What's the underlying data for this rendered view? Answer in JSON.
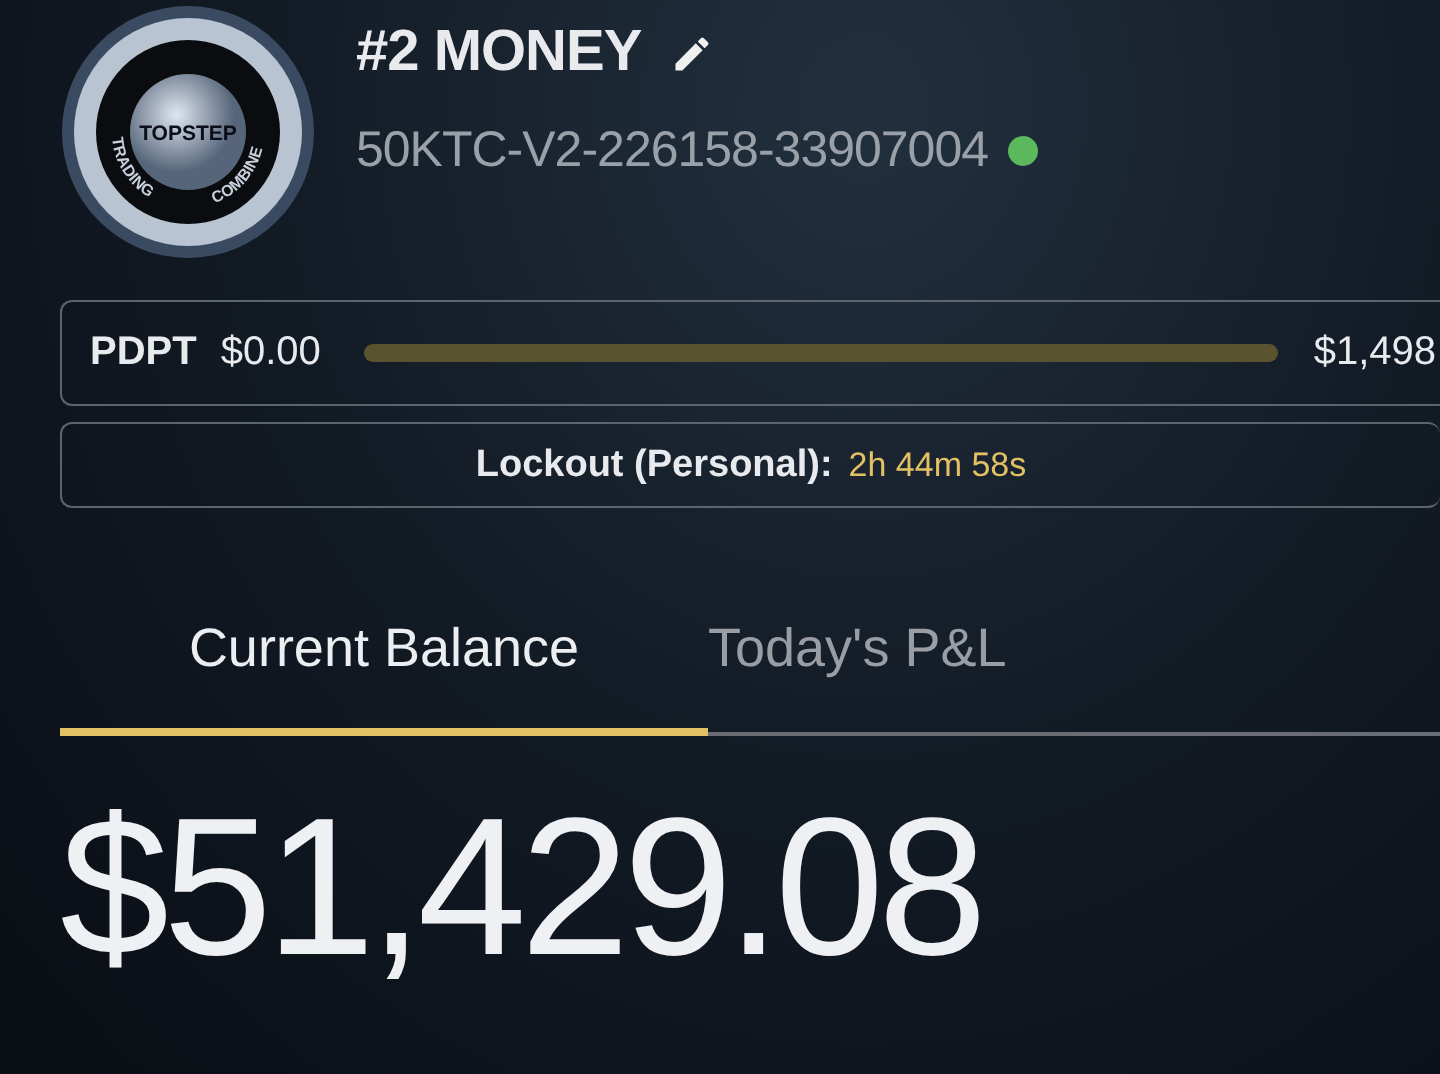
{
  "logo": {
    "center": "TOPSTEP",
    "left": "TRADING",
    "right": "COMBINE"
  },
  "account": {
    "title": "#2 MONEY",
    "id": "50KTC-V2-226158-33907004",
    "status": {
      "color": "#5cb85c"
    }
  },
  "pdpt": {
    "label": "PDPT",
    "start": "$0.00",
    "end": "$1,498",
    "level": 0
  },
  "lockout": {
    "label": "Lockout (Personal):",
    "time": "2h 44m 58s"
  },
  "tabs": [
    {
      "label": "Current Balance",
      "selected": true
    },
    {
      "label": "Today's P&L",
      "selected": false
    }
  ],
  "balance": "$51,429.08"
}
